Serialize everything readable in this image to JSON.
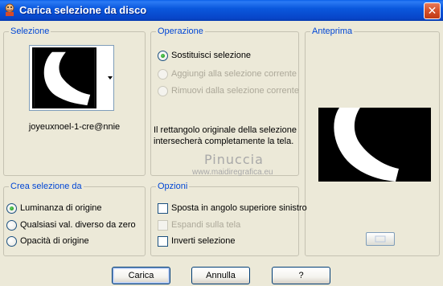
{
  "window": {
    "title": "Carica selezione da disco",
    "close_glyph": "✕"
  },
  "selection_group": {
    "legend": "Selezione",
    "file_name": "joyeuxnoel-1-cre@nnie"
  },
  "operation_group": {
    "legend": "Operazione",
    "options": [
      {
        "label": "Sostituisci selezione",
        "checked": true,
        "disabled": false
      },
      {
        "label": "Aggiungi alla selezione corrente",
        "checked": false,
        "disabled": true
      },
      {
        "label": "Rimuovi dalla selezione corrente",
        "checked": false,
        "disabled": true
      }
    ],
    "info_line1": "Il rettangolo originale della selezione",
    "info_line2": "intersecherà completamente la tela."
  },
  "preview_group": {
    "legend": "Anteprima"
  },
  "watermark": {
    "name": "Pinuccia",
    "url": "www.maidiregrafica.eu"
  },
  "source_group": {
    "legend": "Crea selezione da",
    "options": [
      {
        "label": "Luminanza di origine",
        "checked": true
      },
      {
        "label": "Qualsiasi val. diverso da zero",
        "checked": false
      },
      {
        "label": "Opacità di origine",
        "checked": false
      }
    ]
  },
  "options_group": {
    "legend": "Opzioni",
    "options": [
      {
        "label": "Sposta in angolo superiore sinistro",
        "checked": false,
        "disabled": false
      },
      {
        "label": "Espandi sulla tela",
        "checked": false,
        "disabled": true
      },
      {
        "label": "Inverti selezione",
        "checked": false,
        "disabled": false
      }
    ]
  },
  "buttons": {
    "load": "Carica",
    "cancel": "Annulla",
    "help": "?"
  },
  "colors": {
    "legend_blue": "#0046d5",
    "titlebar_blue": "#0a58dd",
    "dialog_bg": "#ece9d8"
  }
}
